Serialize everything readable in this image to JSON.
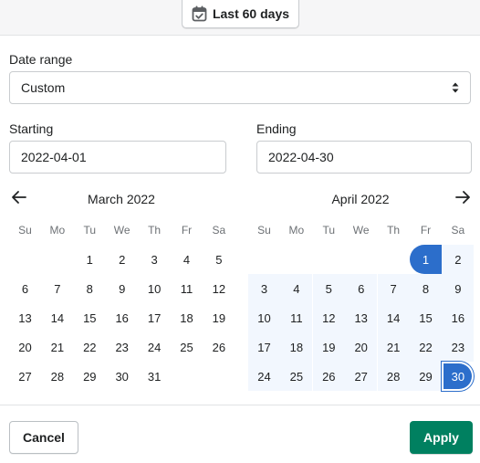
{
  "trigger": {
    "label": "Last 60 days",
    "icon": "calendar-check-icon"
  },
  "date_range": {
    "label": "Date range",
    "value": "Custom"
  },
  "starting": {
    "label": "Starting",
    "value": "2022-04-01"
  },
  "ending": {
    "label": "Ending",
    "value": "2022-04-30"
  },
  "weekdays": [
    "Su",
    "Mo",
    "Tu",
    "We",
    "Th",
    "Fr",
    "Sa"
  ],
  "calendars": [
    {
      "title": "March 2022",
      "first_weekday": 2,
      "days": 31,
      "range_start": null,
      "range_end": null
    },
    {
      "title": "April 2022",
      "first_weekday": 5,
      "days": 30,
      "range_start": 1,
      "range_end": 30
    }
  ],
  "colors": {
    "accent": "#2c6ecb",
    "range_bg": "#f2f7fe",
    "primary": "#008060"
  },
  "footer": {
    "cancel_label": "Cancel",
    "apply_label": "Apply"
  }
}
